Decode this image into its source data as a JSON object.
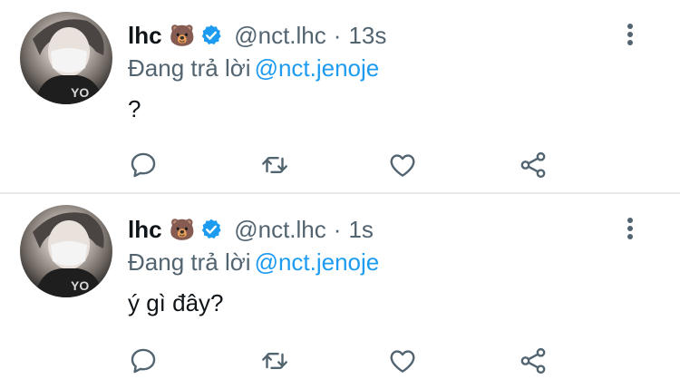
{
  "colors": {
    "text": "#0f1419",
    "secondary": "#536471",
    "accent": "#1d9bf0",
    "divider": "#e7e9ea"
  },
  "tweets": [
    {
      "author": {
        "name": "lhc",
        "emoji": "🐻",
        "verified": true,
        "handle": "@nct.lhc"
      },
      "separator": "·",
      "time": "13s",
      "replying_prefix": "Đang trả lời",
      "replying_to": "@nct.jenoje",
      "text": "?",
      "icons": [
        "reply-icon",
        "retweet-icon",
        "like-icon",
        "share-icon",
        "more-icon"
      ]
    },
    {
      "author": {
        "name": "lhc",
        "emoji": "🐻",
        "verified": true,
        "handle": "@nct.lhc"
      },
      "separator": "·",
      "time": "1s",
      "replying_prefix": "Đang trả lời",
      "replying_to": "@nct.jenoje",
      "text": "ý gì đây?",
      "icons": [
        "reply-icon",
        "retweet-icon",
        "like-icon",
        "share-icon",
        "more-icon"
      ]
    }
  ]
}
